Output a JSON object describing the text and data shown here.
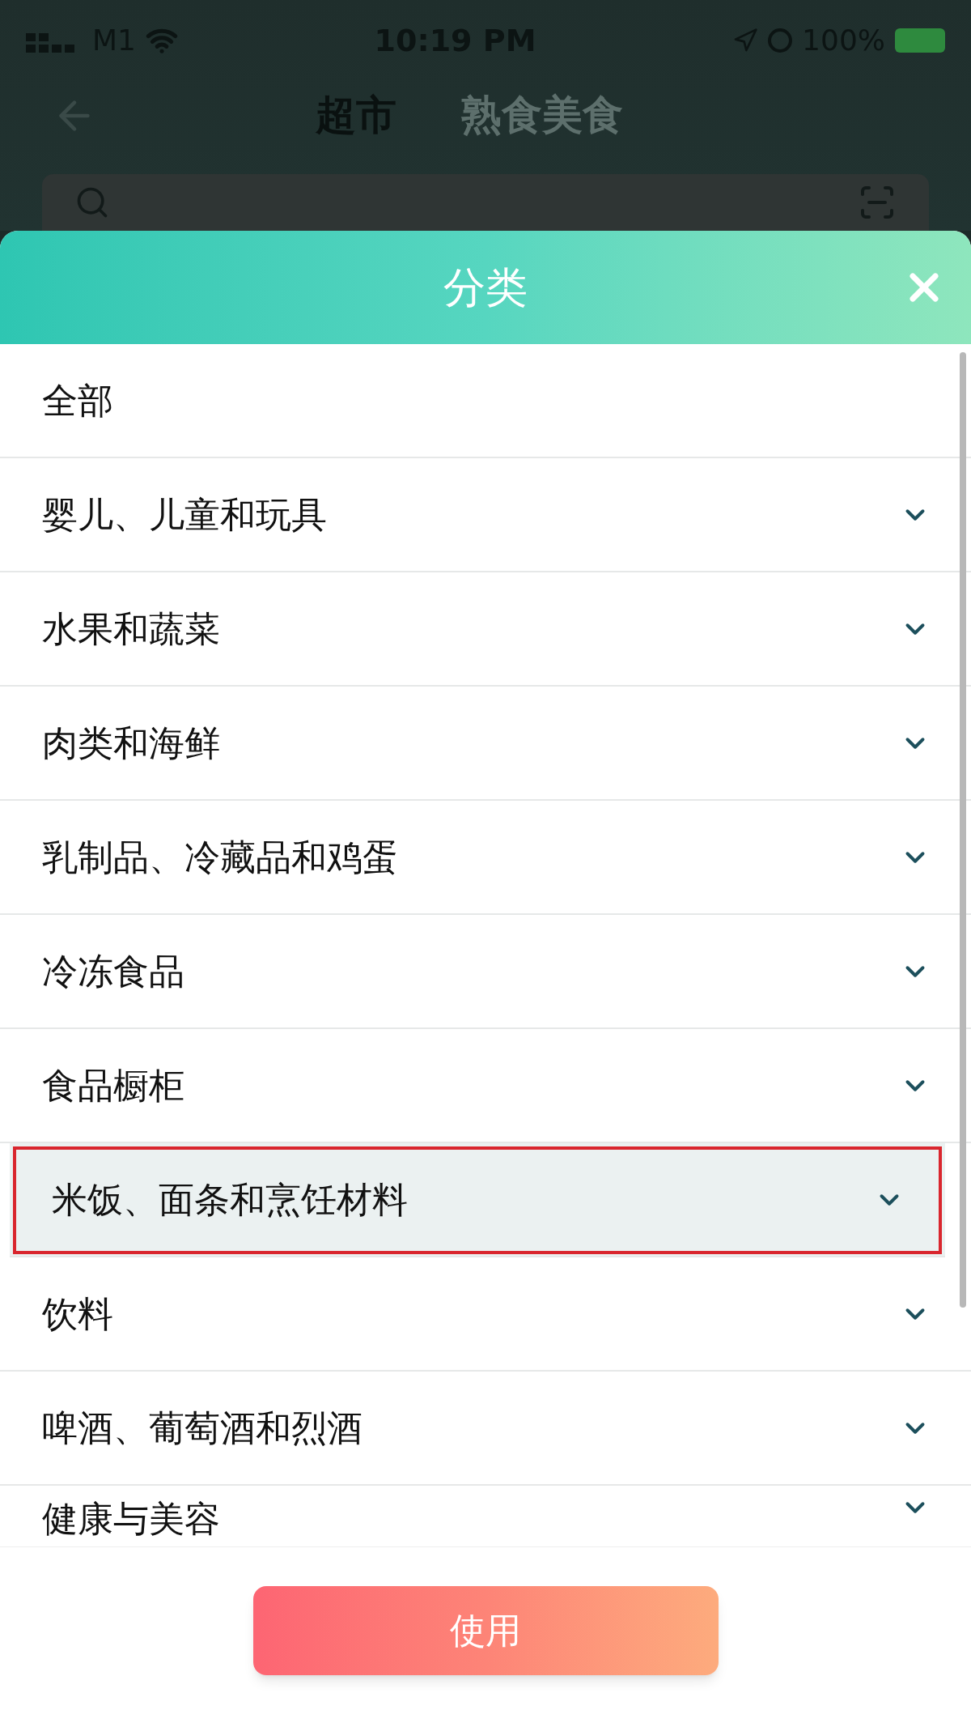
{
  "status_bar": {
    "carrier": "M1",
    "time": "10:19 PM",
    "battery": "100%"
  },
  "nav": {
    "tabs": [
      {
        "label": "超市",
        "selected": true
      },
      {
        "label": "熟食美食",
        "selected": false
      }
    ]
  },
  "sheet": {
    "title": "分类",
    "categories": [
      {
        "label": "全部",
        "expandable": false,
        "selected": false
      },
      {
        "label": "婴儿、儿童和玩具",
        "expandable": true,
        "selected": false
      },
      {
        "label": "水果和蔬菜",
        "expandable": true,
        "selected": false
      },
      {
        "label": "肉类和海鲜",
        "expandable": true,
        "selected": false
      },
      {
        "label": "乳制品、冷藏品和鸡蛋",
        "expandable": true,
        "selected": false
      },
      {
        "label": "冷冻食品",
        "expandable": true,
        "selected": false
      },
      {
        "label": "食品橱柜",
        "expandable": true,
        "selected": false
      },
      {
        "label": "米饭、面条和烹饪材料",
        "expandable": true,
        "selected": true
      },
      {
        "label": "饮料",
        "expandable": true,
        "selected": false
      },
      {
        "label": "啤酒、葡萄酒和烈酒",
        "expandable": true,
        "selected": false
      },
      {
        "label": "健康与美容",
        "expandable": true,
        "selected": false
      }
    ],
    "button": "使用"
  }
}
